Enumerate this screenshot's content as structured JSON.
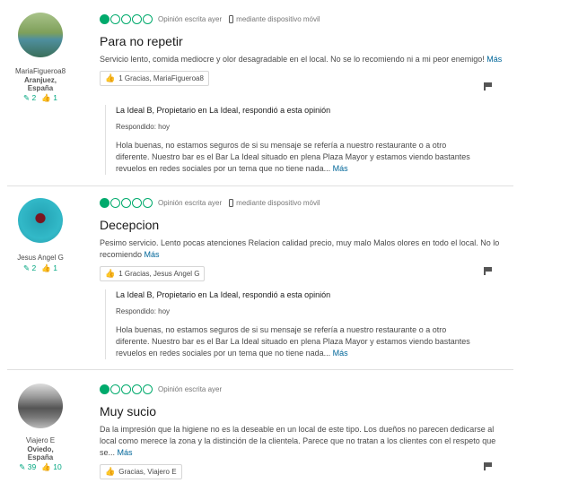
{
  "reviews": [
    {
      "member": {
        "name": "MariaFigueroa8",
        "location_line1": "Aranjuez,",
        "location_line2": "España",
        "reviews_count": "2",
        "helpful_count": "1"
      },
      "rating_bubbles": 1,
      "written": "Opinión escrita ayer",
      "mobile": "mediante dispositivo móvil",
      "title": "Para no repetir",
      "body": "Servicio lento, comida mediocre y olor desagradable en el local. No se lo recomiendo ni a mi peor enemigo!",
      "more": "Más",
      "thanks": "1  Gracias, MariaFigueroa8",
      "response": {
        "header": "La Ideal B, Propietario en La Ideal, respondió a esta opinión",
        "date": "Respondido: hoy",
        "body": "Hola buenas, no estamos seguros de si su mensaje se refería a nuestro restaurante o a otro diferente. Nuestro bar es el Bar La Ideal situado en plena Plaza Mayor y estamos viendo bastantes revuelos en redes sociales por un tema que no tiene nada...",
        "more": "Más"
      }
    },
    {
      "member": {
        "name": "Jesus Angel G",
        "reviews_count": "2",
        "helpful_count": "1"
      },
      "rating_bubbles": 1,
      "written": "Opinión escrita ayer",
      "mobile": "mediante dispositivo móvil",
      "title": "Decepcion",
      "body": "Pesimo servicio. Lento pocas atenciones Relacion calidad precio, muy malo Malos olores en todo el local. No lo recomiendo",
      "more": "Más",
      "thanks": "1  Gracias, Jesus Angel G",
      "response": {
        "header": "La Ideal B, Propietario en La Ideal, respondió a esta opinión",
        "date": "Respondido: hoy",
        "body": "Hola buenas, no estamos seguros de si su mensaje se refería a nuestro restaurante o a otro diferente. Nuestro bar es el Bar La Ideal situado en plena Plaza Mayor y estamos viendo bastantes revuelos en redes sociales por un tema que no tiene nada...",
        "more": "Más"
      }
    },
    {
      "member": {
        "name": "Viajero E",
        "location_line1": "Oviedo,",
        "location_line2": "España",
        "reviews_count": "39",
        "helpful_count": "10"
      },
      "rating_bubbles": 1,
      "written": "Opinión escrita ayer",
      "title": "Muy sucio",
      "body": "Da la impresión que la higiene no es la deseable en un local de este tipo. Los dueños no parecen dedicarse al local como merece la zona y la distinción de la clientela. Parece que no tratan a los clientes con el respeto que se...",
      "more": "Más",
      "thanks": "Gracias, Viajero E"
    }
  ],
  "colors": {
    "accent": "#00aa6c",
    "link": "#006699"
  },
  "icons": [
    "review-count-icon",
    "helpful-votes-icon",
    "thumbs-up-icon",
    "flag-icon",
    "mobile-phone-icon",
    "rating-bubble-icon"
  ]
}
